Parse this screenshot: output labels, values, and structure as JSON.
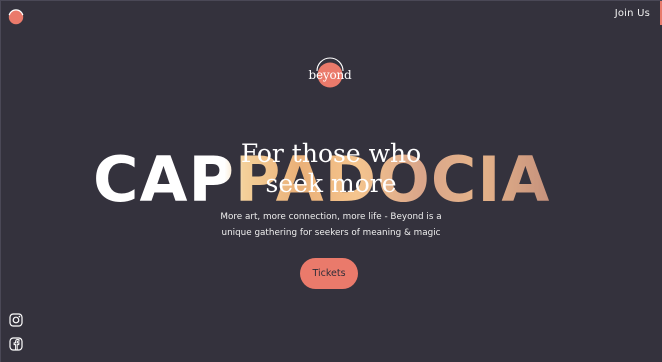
{
  "header": {
    "join_label": "Join Us"
  },
  "brand": {
    "wordmark": "beyond"
  },
  "hero": {
    "background_word": "CAPPADOCIA",
    "headline_line1": "For those who",
    "headline_line2": "seek more",
    "tagline_line1": "More art, more connection, more life - Beyond is a",
    "tagline_line2": "unique gathering for seekers of meaning & magic",
    "cta_label": "Tickets"
  },
  "social": {
    "icons": [
      "instagram-icon",
      "facebook-icon"
    ]
  },
  "colors": {
    "background": "#34323d",
    "accent": "#ea7a6b",
    "text": "#ffffff"
  }
}
